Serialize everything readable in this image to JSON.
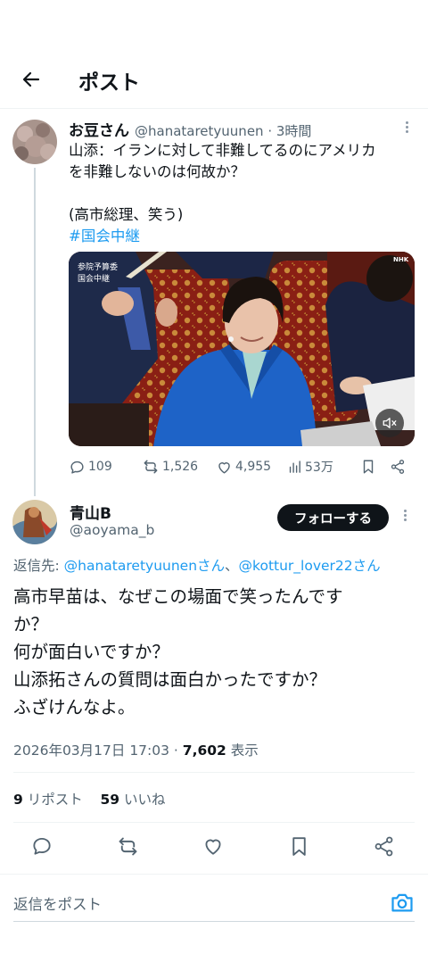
{
  "header": {
    "title": "ポスト"
  },
  "parent_tweet": {
    "name": "お豆さん",
    "handle": "@hanataretyuunen · 3時間",
    "text_lines": [
      "山添：イランに対して非難してるのにアメリカ",
      "を非難しないのは何故か？",
      "",
      "(高市総理、笑う)"
    ],
    "hashtag": "#国会中継",
    "video_overlay_label": "参院予算委\n国会中継",
    "video_corner_label": "NHK",
    "actions": {
      "replies": "109",
      "reposts": "1,526",
      "likes": "4,955",
      "views": "53万"
    }
  },
  "main_tweet": {
    "name": "青山B",
    "handle": "@aoyama_b",
    "follow_label": "フォローする",
    "replying_prefix": "返信先: ",
    "replying_to_1": "@hanataretyuunenさん",
    "replying_sep": "、",
    "replying_to_2": "@kottur_lover22さん",
    "text_lines": [
      "高市早苗は、なぜこの場面で笑ったんです",
      "か？",
      "何が面白いですか？",
      "山添拓さんの質問は面白かったですか？",
      "ふざけんなよ。"
    ],
    "timestamp": "2026年03月17日 17:03 · ",
    "views": "7,602",
    "views_label": " 表示",
    "reposts_count": "9",
    "reposts_label": " リポスト",
    "likes_count": "59",
    "likes_label": " いいね"
  },
  "reply_bar": {
    "placeholder": "返信をポスト"
  },
  "colors": {
    "accent": "#1d9bf0",
    "text": "#0f1419",
    "muted": "#536471"
  }
}
